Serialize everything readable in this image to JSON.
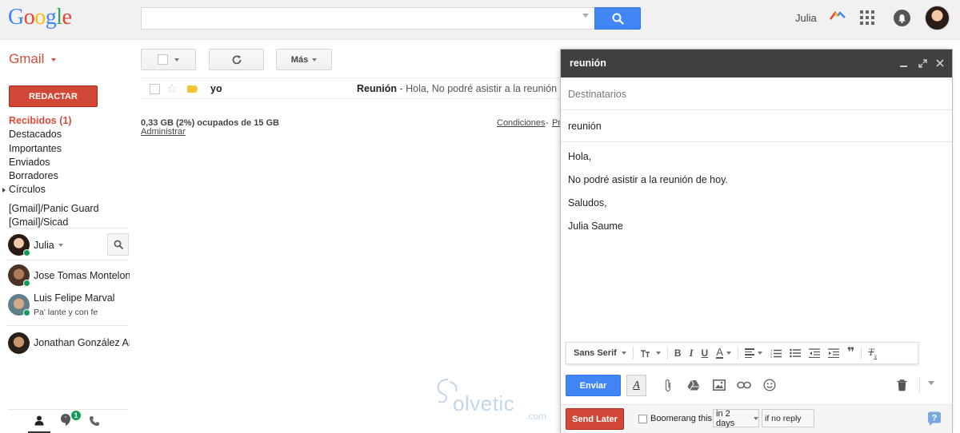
{
  "header": {
    "logo_letters": [
      "G",
      "o",
      "o",
      "g",
      "l",
      "e"
    ],
    "logo_colors": [
      "#4285f4",
      "#ea4335",
      "#fbbc05",
      "#4285f4",
      "#34a853",
      "#ea4335"
    ],
    "search_value": "",
    "user_name": "Julia"
  },
  "nav": {
    "gmail_label": "Gmail",
    "compose_label": "REDACTAR",
    "folders": [
      "Recibidos (1)",
      "Destacados",
      "Importantes",
      "Enviados",
      "Borradores",
      "Círculos",
      "[Gmail]/Panic Guard",
      "[Gmail]/Sicad"
    ]
  },
  "chat": {
    "self_name": "Julia",
    "contacts": [
      {
        "name": "Jose Tomas Montelongo",
        "status": ""
      },
      {
        "name": "Luis Felipe Marval",
        "status": "Pa' lante y con fe"
      },
      {
        "name": "Jonathan González Amador",
        "status": ""
      }
    ],
    "hangouts_badge": "1"
  },
  "toolbar": {
    "more_label": "Más"
  },
  "message_list": {
    "rows": [
      {
        "sender": "yo",
        "subject": "Reunión",
        "snippet": " - Hola, No podré asistir a la reunión de hoy"
      }
    ],
    "storage_text": "0,33 GB (2%) ocupados de 15 GB",
    "manage_label": "Administrar",
    "terms_label": "Condiciones",
    "terms_dash": "-",
    "privacy_label": "Privacidad"
  },
  "compose": {
    "title": "reunión",
    "to_placeholder": "Destinatarios",
    "subject": "reunión",
    "body_lines": [
      "Hola,",
      "No podré asistir a la reunión de hoy.",
      "Saludos,",
      "Julia Saume"
    ],
    "font_label": "Sans Serif",
    "send_label": "Enviar",
    "send_later_label": "Send Later",
    "boomerang_label": "Boomerang this",
    "when_value": "in 2 days",
    "condition_value": "if no reply"
  },
  "watermark": {
    "text": "olvetic",
    "suffix": ".com"
  },
  "colors": {
    "accent_red": "#d14836",
    "accent_blue": "#4285f4",
    "compose_header": "#404040",
    "online": "#0f9d58"
  }
}
